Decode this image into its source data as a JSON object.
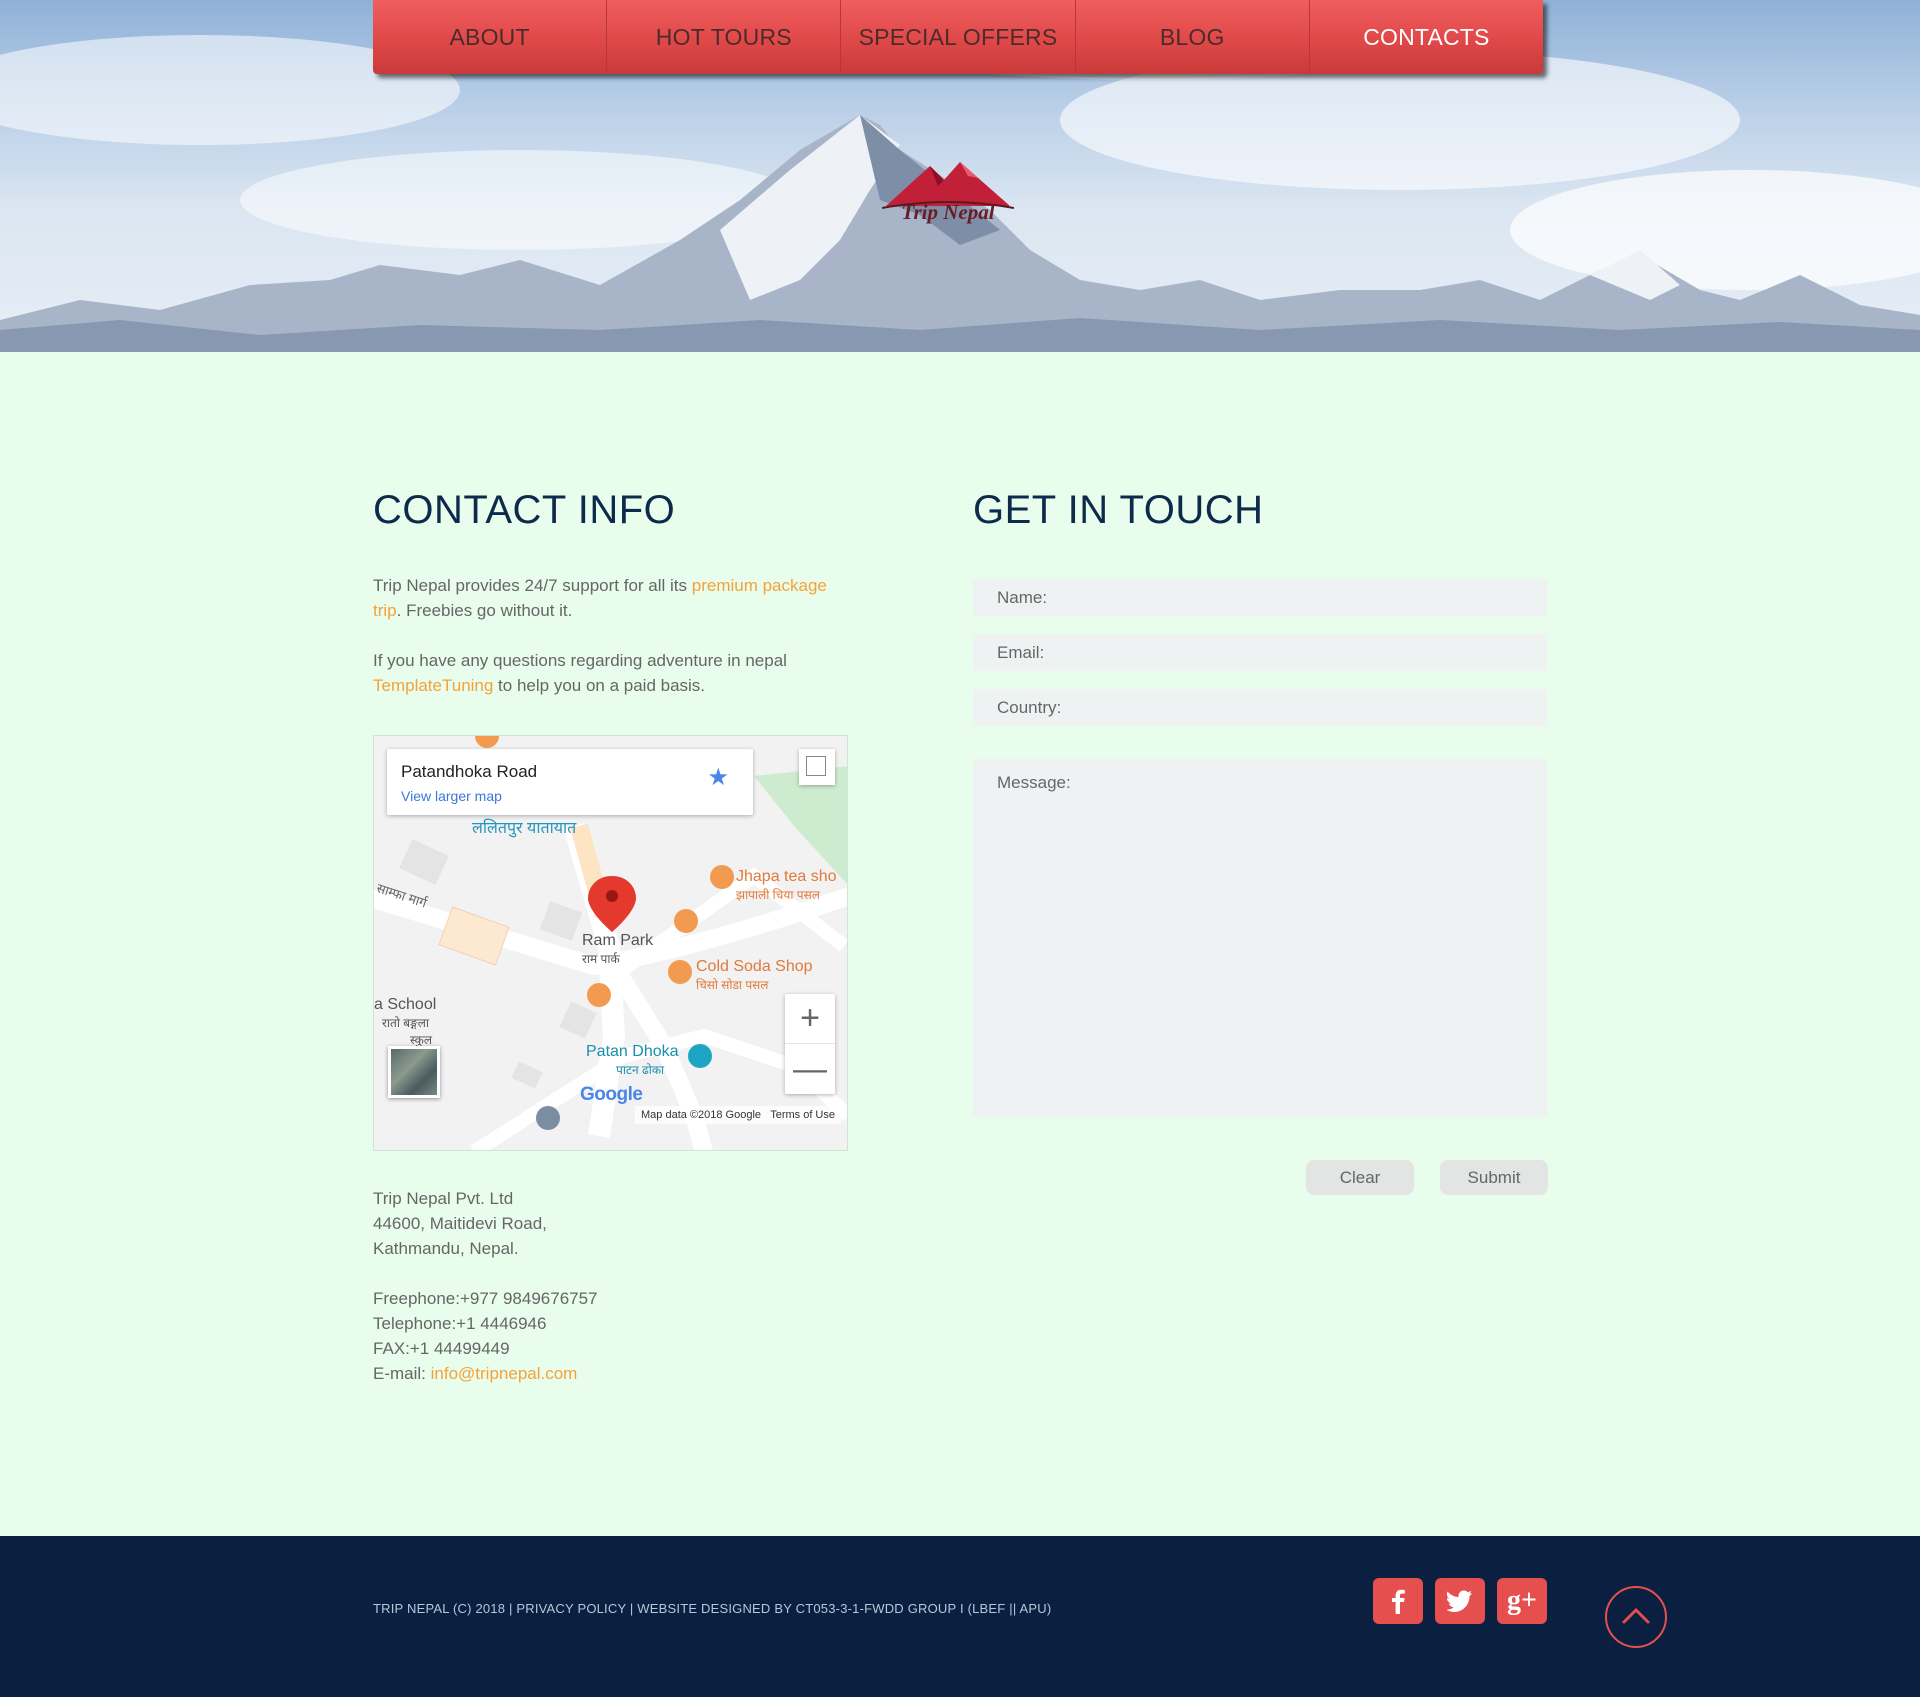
{
  "nav": {
    "items": [
      {
        "label": "ABOUT"
      },
      {
        "label": "HOT TOURS"
      },
      {
        "label": "SPECIAL OFFERS"
      },
      {
        "label": "BLOG"
      },
      {
        "label": "CONTACTS"
      }
    ],
    "active": "CONTACTS"
  },
  "logo": {
    "text": "Trip Nepal"
  },
  "contact_info": {
    "title": "CONTACT INFO",
    "p1_before": "Trip Nepal provides 24/7 support for all its ",
    "p1_link": "premium package trip",
    "p1_after": ". Freebies go without it.",
    "p2_before": "If you have any questions regarding adventure in nepal ",
    "p2_link": "TemplateTuning",
    "p2_after": " to help you on a paid basis."
  },
  "map": {
    "place_title": "Patandhoka Road",
    "view_larger": "View larger map",
    "labels": {
      "transport": "ललितपुर यातायात",
      "road": "साम्फा मार्ग",
      "ram_park": "Ram Park",
      "ram_park_local": "राम पार्क",
      "jhapa": "Jhapa tea sho",
      "jhapa_local": "झापाली चिया पसल",
      "cold_soda": "Cold Soda Shop",
      "cold_soda_local": "चिसो सोडा पसल",
      "school": "a School",
      "school_local_1": "रातो बङ्गला",
      "school_local_2": "स्कुल",
      "patan_dhoka": "Patan Dhoka",
      "patan_dhoka_local": "पाटन ढोका"
    },
    "google": "Google",
    "map_data": "Map data ©2018 Google",
    "terms": "Terms of Use",
    "zoom_in": "+",
    "zoom_out": "—"
  },
  "address": {
    "line1": "Trip Nepal Pvt. Ltd",
    "line2": "44600, Maitidevi Road,",
    "line3": "Kathmandu, Nepal."
  },
  "phones": {
    "freephone": "Freephone:+977 9849676757",
    "telephone": "Telephone:+1 4446946",
    "fax": "FAX:+1 44499449",
    "email_label": "E-mail: ",
    "email": "info@tripnepal.com"
  },
  "form": {
    "title": "GET IN TOUCH",
    "name_placeholder": "Name:",
    "email_placeholder": "Email:",
    "country_placeholder": "Country:",
    "message_placeholder": "Message:",
    "clear_label": "Clear",
    "submit_label": "Submit"
  },
  "footer": {
    "copyright": "TRIP NEPAL (C) 2018 | PRIVACY POLICY | WEBSITE DESIGNED BY CT053-3-1-FWDD GROUP I (LBEF || APU)",
    "social": [
      {
        "icon": "facebook-icon",
        "glyph": "f"
      },
      {
        "icon": "twitter-icon",
        "glyph": "t"
      },
      {
        "icon": "google-plus-icon",
        "glyph": "g+"
      }
    ],
    "accent": "#e5504f",
    "background": "#0b2040"
  }
}
